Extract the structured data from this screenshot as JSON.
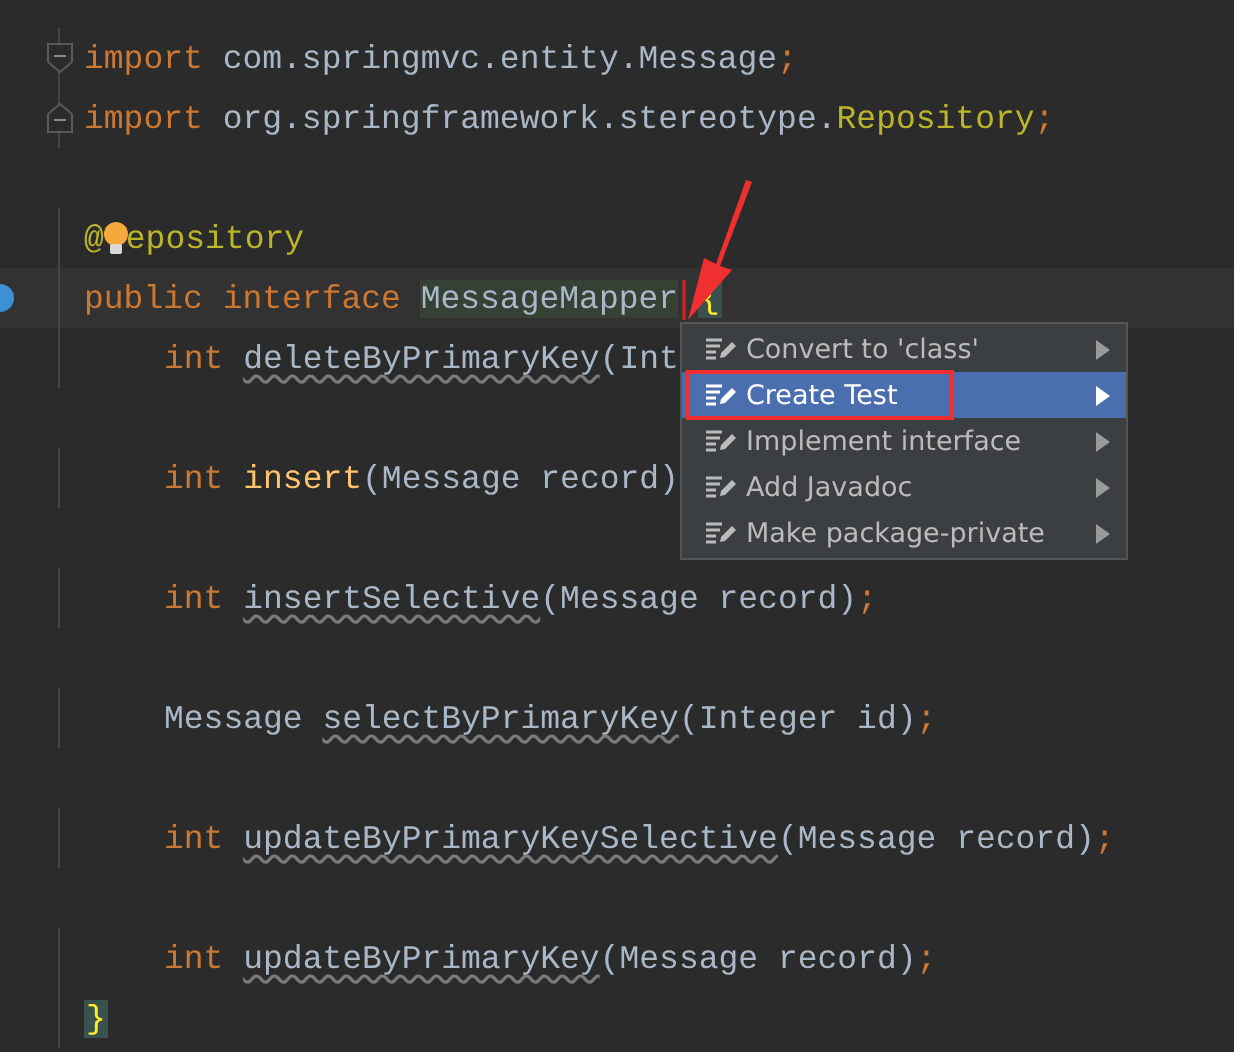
{
  "editor": {
    "lines": [
      {
        "kind": "code",
        "fold_start": true,
        "tokens": [
          {
            "text": "import",
            "kind": "keyword"
          },
          {
            "text": "com.springmvc.entity.Message",
            "kind": "plain",
            "space_before": true
          },
          {
            "text": ";",
            "kind": "keyword"
          }
        ]
      },
      {
        "kind": "code",
        "fold_end": true,
        "tokens": [
          {
            "text": "import",
            "kind": "keyword"
          },
          {
            "text": "org.springframework.stereotype.",
            "kind": "plain",
            "space_before": true
          },
          {
            "text": "Repository",
            "kind": "annotation"
          },
          {
            "text": ";",
            "kind": "keyword"
          }
        ]
      },
      {
        "kind": "blank"
      },
      {
        "kind": "code",
        "bulb": true,
        "tokens": [
          {
            "text": "@",
            "kind": "annotation"
          },
          {
            "text": "epository",
            "kind": "annotation"
          }
        ]
      },
      {
        "kind": "code",
        "current": true,
        "gutter_marker": true,
        "tokens": [
          {
            "text": "public",
            "kind": "keyword"
          },
          {
            "text": "interface",
            "kind": "keyword",
            "space_before": true
          },
          {
            "text": "MessageMapper",
            "kind": "highlighted_name",
            "space_before": true
          },
          {
            "text": "{",
            "kind": "matched_brace",
            "space_before": true
          }
        ]
      },
      {
        "kind": "code",
        "indented": true,
        "tokens": [
          {
            "text": "int",
            "kind": "keyword"
          },
          {
            "text": "deleteByPrimaryKey",
            "kind": "unused",
            "space_before": true
          },
          {
            "text": "(Int",
            "kind": "plain"
          }
        ]
      },
      {
        "kind": "blank"
      },
      {
        "kind": "code",
        "indented": true,
        "tokens": [
          {
            "text": "int",
            "kind": "keyword"
          },
          {
            "text": "insert",
            "kind": "declaration",
            "space_before": true
          },
          {
            "text": "(Message record)",
            "kind": "plain"
          }
        ]
      },
      {
        "kind": "blank"
      },
      {
        "kind": "code",
        "indented": true,
        "tokens": [
          {
            "text": "int",
            "kind": "keyword"
          },
          {
            "text": "insertSelective",
            "kind": "unused",
            "space_before": true
          },
          {
            "text": "(Message record)",
            "kind": "plain"
          },
          {
            "text": ";",
            "kind": "keyword"
          }
        ]
      },
      {
        "kind": "blank"
      },
      {
        "kind": "code",
        "indented": true,
        "tokens": [
          {
            "text": "Message",
            "kind": "plain"
          },
          {
            "text": "selectByPrimaryKey",
            "kind": "unused",
            "space_before": true
          },
          {
            "text": "(Integer id)",
            "kind": "plain"
          },
          {
            "text": ";",
            "kind": "keyword"
          }
        ]
      },
      {
        "kind": "blank"
      },
      {
        "kind": "code",
        "indented": true,
        "tokens": [
          {
            "text": "int",
            "kind": "keyword"
          },
          {
            "text": "updateByPrimaryKeySelective",
            "kind": "unused",
            "space_before": true
          },
          {
            "text": "(Message record)",
            "kind": "plain"
          },
          {
            "text": ";",
            "kind": "keyword"
          }
        ]
      },
      {
        "kind": "blank"
      },
      {
        "kind": "code",
        "indented": true,
        "tokens": [
          {
            "text": "int",
            "kind": "keyword"
          },
          {
            "text": "updateByPrimaryKey",
            "kind": "unused",
            "space_before": true
          },
          {
            "text": "(Message record)",
            "kind": "plain"
          },
          {
            "text": ";",
            "kind": "keyword"
          }
        ]
      },
      {
        "kind": "code",
        "tokens": [
          {
            "text": "}",
            "kind": "matched_brace"
          }
        ]
      }
    ]
  },
  "context_menu": {
    "items": [
      {
        "label": "Convert to 'class'",
        "selected": false
      },
      {
        "label": "Create Test",
        "selected": true
      },
      {
        "label": "Implement interface",
        "selected": false
      },
      {
        "label": "Add Javadoc",
        "selected": false
      },
      {
        "label": "Make package-private",
        "selected": false
      }
    ]
  }
}
